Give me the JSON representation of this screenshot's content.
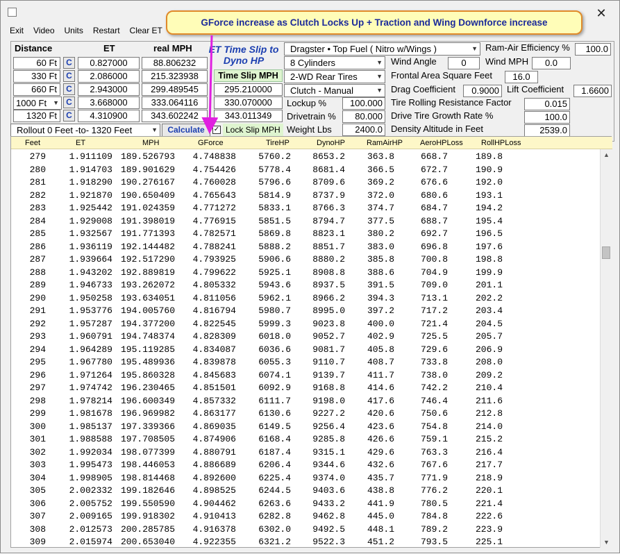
{
  "menu": [
    "Exit",
    "Video",
    "Units",
    "Restart",
    "Clear ET"
  ],
  "callout": "GForce increase as Clutch Locks Up + Traction and Wing Downforce increase",
  "headers": {
    "distance": "Distance",
    "et": "ET",
    "mph": "real MPH"
  },
  "c_label": "C",
  "distances": [
    {
      "label": "60 Ft",
      "et": "0.827000",
      "mph": "88.806232"
    },
    {
      "label": "330 Ft",
      "et": "2.086000",
      "mph": "215.323938"
    },
    {
      "label": "660 Ft",
      "et": "2.943000",
      "mph": "299.489545"
    },
    {
      "label": "1000 Ft",
      "et": "3.668000",
      "mph": "333.064116"
    },
    {
      "label": "1320 Ft",
      "et": "4.310900",
      "mph": "343.602242"
    }
  ],
  "rollout": "Rollout 0 Feet -to- 1320 Feet",
  "timeslip_title": "ET Time Slip to Dyno HP",
  "timeslip_mph_label": "Time Slip MPH",
  "timeslip_mph": [
    "295.210000",
    "330.070000",
    "343.011349"
  ],
  "calculate": "Calculate",
  "lock_mph": {
    "label": "Lock Slip MPH",
    "checked": true
  },
  "combos": [
    "Dragster • Top Fuel ( Nitro w/Wings )",
    "8  Cylinders",
    "2-WD Rear Tires",
    "Clutch - Manual"
  ],
  "lockup": {
    "label": "Lockup %",
    "value": "100.000"
  },
  "drivetrain": {
    "label": "Drivetrain %",
    "value": "80.000"
  },
  "weight": {
    "label": "Weight Lbs",
    "value": "2400.0"
  },
  "ram_air": {
    "label": "Ram-Air Efficiency %",
    "value": "100.0"
  },
  "wind_angle": {
    "label": "Wind Angle",
    "value": "0"
  },
  "wind_mph": {
    "label": "Wind MPH",
    "value": "0.0"
  },
  "frontal": {
    "label": "Frontal Area Square Feet",
    "value": "16.0"
  },
  "drag": {
    "label": "Drag Coefficient",
    "value": "0.9000"
  },
  "lift": {
    "label": "Lift Coefficient",
    "value": "1.6600"
  },
  "rolling": {
    "label": "Tire Rolling Resistance Factor",
    "value": "0.015"
  },
  "growth": {
    "label": "Drive Tire Growth Rate %",
    "value": "100.0"
  },
  "density": {
    "label": "Density Altitude in Feet",
    "value": "2539.0"
  },
  "columns": [
    "Feet",
    "ET",
    "MPH",
    "GForce",
    "TireHP",
    "DynoHP",
    "RamAirHP",
    "AeroHPLoss",
    "RollHPLoss"
  ],
  "rows": [
    [
      "279",
      "1.911109",
      "189.526793",
      "4.748838",
      "5760.2",
      "8653.2",
      "363.8",
      "668.7",
      "189.8"
    ],
    [
      "280",
      "1.914703",
      "189.901629",
      "4.754426",
      "5778.4",
      "8681.4",
      "366.5",
      "672.7",
      "190.9"
    ],
    [
      "281",
      "1.918290",
      "190.276167",
      "4.760028",
      "5796.6",
      "8709.6",
      "369.2",
      "676.6",
      "192.0"
    ],
    [
      "282",
      "1.921870",
      "190.650409",
      "4.765643",
      "5814.9",
      "8737.9",
      "372.0",
      "680.6",
      "193.1"
    ],
    [
      "283",
      "1.925442",
      "191.024359",
      "4.771272",
      "5833.1",
      "8766.3",
      "374.7",
      "684.7",
      "194.2"
    ],
    [
      "284",
      "1.929008",
      "191.398019",
      "4.776915",
      "5851.5",
      "8794.7",
      "377.5",
      "688.7",
      "195.4"
    ],
    [
      "285",
      "1.932567",
      "191.771393",
      "4.782571",
      "5869.8",
      "8823.1",
      "380.2",
      "692.7",
      "196.5"
    ],
    [
      "286",
      "1.936119",
      "192.144482",
      "4.788241",
      "5888.2",
      "8851.7",
      "383.0",
      "696.8",
      "197.6"
    ],
    [
      "287",
      "1.939664",
      "192.517290",
      "4.793925",
      "5906.6",
      "8880.2",
      "385.8",
      "700.8",
      "198.8"
    ],
    [
      "288",
      "1.943202",
      "192.889819",
      "4.799622",
      "5925.1",
      "8908.8",
      "388.6",
      "704.9",
      "199.9"
    ],
    [
      "289",
      "1.946733",
      "193.262072",
      "4.805332",
      "5943.6",
      "8937.5",
      "391.5",
      "709.0",
      "201.1"
    ],
    [
      "290",
      "1.950258",
      "193.634051",
      "4.811056",
      "5962.1",
      "8966.2",
      "394.3",
      "713.1",
      "202.2"
    ],
    [
      "291",
      "1.953776",
      "194.005760",
      "4.816794",
      "5980.7",
      "8995.0",
      "397.2",
      "717.2",
      "203.4"
    ],
    [
      "292",
      "1.957287",
      "194.377200",
      "4.822545",
      "5999.3",
      "9023.8",
      "400.0",
      "721.4",
      "204.5"
    ],
    [
      "293",
      "1.960791",
      "194.748374",
      "4.828309",
      "6018.0",
      "9052.7",
      "402.9",
      "725.5",
      "205.7"
    ],
    [
      "294",
      "1.964289",
      "195.119285",
      "4.834087",
      "6036.6",
      "9081.7",
      "405.8",
      "729.6",
      "206.9"
    ],
    [
      "295",
      "1.967780",
      "195.489936",
      "4.839878",
      "6055.3",
      "9110.7",
      "408.7",
      "733.8",
      "208.0"
    ],
    [
      "296",
      "1.971264",
      "195.860328",
      "4.845683",
      "6074.1",
      "9139.7",
      "411.7",
      "738.0",
      "209.2"
    ],
    [
      "297",
      "1.974742",
      "196.230465",
      "4.851501",
      "6092.9",
      "9168.8",
      "414.6",
      "742.2",
      "210.4"
    ],
    [
      "298",
      "1.978214",
      "196.600349",
      "4.857332",
      "6111.7",
      "9198.0",
      "417.6",
      "746.4",
      "211.6"
    ],
    [
      "299",
      "1.981678",
      "196.969982",
      "4.863177",
      "6130.6",
      "9227.2",
      "420.6",
      "750.6",
      "212.8"
    ],
    [
      "300",
      "1.985137",
      "197.339366",
      "4.869035",
      "6149.5",
      "9256.4",
      "423.6",
      "754.8",
      "214.0"
    ],
    [
      "301",
      "1.988588",
      "197.708505",
      "4.874906",
      "6168.4",
      "9285.8",
      "426.6",
      "759.1",
      "215.2"
    ],
    [
      "302",
      "1.992034",
      "198.077399",
      "4.880791",
      "6187.4",
      "9315.1",
      "429.6",
      "763.3",
      "216.4"
    ],
    [
      "303",
      "1.995473",
      "198.446053",
      "4.886689",
      "6206.4",
      "9344.6",
      "432.6",
      "767.6",
      "217.7"
    ],
    [
      "304",
      "1.998905",
      "198.814468",
      "4.892600",
      "6225.4",
      "9374.0",
      "435.7",
      "771.9",
      "218.9"
    ],
    [
      "305",
      "2.002332",
      "199.182646",
      "4.898525",
      "6244.5",
      "9403.6",
      "438.8",
      "776.2",
      "220.1"
    ],
    [
      "306",
      "2.005752",
      "199.550590",
      "4.904462",
      "6263.6",
      "9433.2",
      "441.9",
      "780.5",
      "221.4"
    ],
    [
      "307",
      "2.009165",
      "199.918302",
      "4.910413",
      "6282.8",
      "9462.8",
      "445.0",
      "784.8",
      "222.6"
    ],
    [
      "308",
      "2.012573",
      "200.285785",
      "4.916378",
      "6302.0",
      "9492.5",
      "448.1",
      "789.2",
      "223.9"
    ],
    [
      "309",
      "2.015974",
      "200.653040",
      "4.922355",
      "6321.2",
      "9522.3",
      "451.2",
      "793.5",
      "225.1"
    ]
  ]
}
